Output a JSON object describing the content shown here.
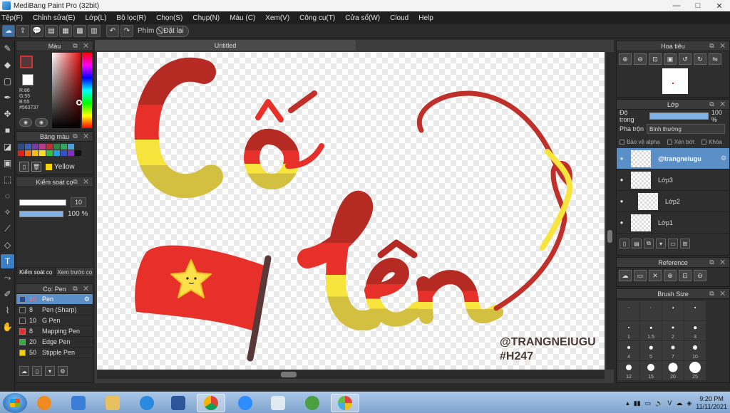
{
  "window": {
    "title": "MediBang Paint Pro (32bit)",
    "controls": [
      "—",
      "□",
      "✕"
    ]
  },
  "menu": [
    "Tệp(F)",
    "Chỉnh sửa(E)",
    "Lớp(L)",
    "Bộ lọc(R)",
    "Chọn(S)",
    "Chụp(N)",
    "Màu (C)",
    "Xem(V)",
    "Công cụ(T)",
    "Cửa sổ(W)",
    "Cloud",
    "Help"
  ],
  "toolbar": {
    "shortcut_label": "Phím",
    "reset_label": "Đặt lại",
    "reset_icon": "⃠"
  },
  "color_panel": {
    "title": "Màu",
    "fg_color": "#563737",
    "values": [
      "R:86",
      "G:55",
      "B:55",
      "#563737"
    ]
  },
  "palette_panel": {
    "title": "Bảng màu",
    "colors": [
      "#2d4a8a",
      "#3860b8",
      "#7a3aa8",
      "#c03a8a",
      "#c03030",
      "#2a8a40",
      "#30a860",
      "#4aa0d8",
      "#2a2a2a",
      "#e02020",
      "#f07010",
      "#f0c010",
      "#f5e020",
      "#30c040",
      "#20a0e0",
      "#3050d0",
      "#8030c0",
      "#101010"
    ],
    "selected_name": "Yellow"
  },
  "brush_control": {
    "title": "Kiểm soát cọ",
    "size_value": "10",
    "opacity_value": "100 %",
    "tab_control": "Kiểm soát cọ",
    "tab_preview": "Xem trước cọ"
  },
  "brush_list": {
    "title": "Cọ: Pen",
    "items": [
      {
        "size": "10",
        "name": "Pen",
        "color": "#2a4a8a",
        "selected": true
      },
      {
        "size": "8",
        "name": "Pen (Sharp)",
        "color": "#2a2a2a",
        "selected": false
      },
      {
        "size": "10",
        "name": "G Pen",
        "color": "#2a2a2a",
        "selected": false
      },
      {
        "size": "8",
        "name": "Mapping Pen",
        "color": "#e03030",
        "selected": false
      },
      {
        "size": "20",
        "name": "Edge Pen",
        "color": "#30b040",
        "selected": false
      },
      {
        "size": "50",
        "name": "Stipple Pen",
        "color": "#f0d010",
        "selected": false
      }
    ]
  },
  "document": {
    "tab_title": "Untitled",
    "artwork": {
      "signature_line1": "@TRANGNEIUGU",
      "signature_line2": "#H247",
      "colors": {
        "red": "#e8302a",
        "dark_red": "#b52a22",
        "yellow": "#f7e43c",
        "olive": "#d4c040",
        "star": "#fbe04a",
        "pole": "#5a3838"
      }
    }
  },
  "navigator": {
    "title": "Hoa tiêu",
    "icons": [
      "zoom-in",
      "zoom-out",
      "fit",
      "actual",
      "rotate-l",
      "rotate-r",
      "flip",
      "reset"
    ]
  },
  "layers": {
    "title": "Lớp",
    "opacity_label": "Độ trong",
    "opacity_value": "100 %",
    "blend_label": "Pha trộn",
    "blend_value": "Bình thường",
    "protect_alpha": "Bảo vệ alpha",
    "clipping": "Xén bớt",
    "lock": "Khóa",
    "items": [
      {
        "name": "@trangneiugu",
        "active": true,
        "indent": false
      },
      {
        "name": "Lớp3",
        "active": false,
        "indent": false
      },
      {
        "name": "Lớp2",
        "active": false,
        "indent": true
      },
      {
        "name": "Lớp1",
        "active": false,
        "indent": false
      }
    ]
  },
  "reference": {
    "title": "Reference"
  },
  "brush_size": {
    "title": "Brush Size",
    "sizes": [
      {
        "label": "",
        "d": 1
      },
      {
        "label": "",
        "d": 1
      },
      {
        "label": "",
        "d": 1.5
      },
      {
        "label": "",
        "d": 2
      },
      {
        "label": "1",
        "d": 2
      },
      {
        "label": "1.5",
        "d": 2.5
      },
      {
        "label": "2",
        "d": 3
      },
      {
        "label": "3",
        "d": 3.5
      },
      {
        "label": "4",
        "d": 4
      },
      {
        "label": "5",
        "d": 4.5
      },
      {
        "label": "7",
        "d": 5
      },
      {
        "label": "10",
        "d": 6
      },
      {
        "label": "12",
        "d": 8
      },
      {
        "label": "15",
        "d": 10
      },
      {
        "label": "20",
        "d": 13
      },
      {
        "label": "25",
        "d": 16
      }
    ]
  },
  "taskbar": {
    "time": "9:20 PM",
    "date": "11/11/2021",
    "lang": "V"
  }
}
